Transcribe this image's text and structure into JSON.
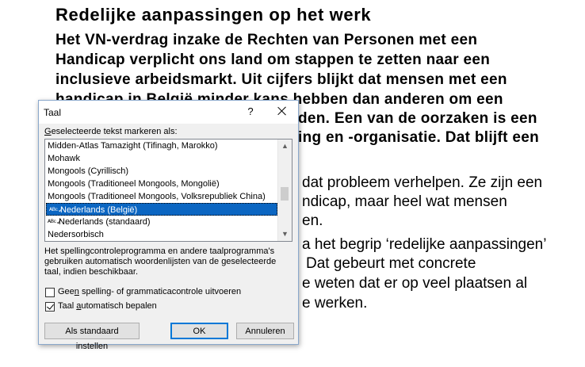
{
  "document": {
    "title": "Redelijke aanpassingen op het werk",
    "lines": [
      "Het VN-verdrag inzake de Rechten van Personen met een",
      "Handicap verplicht ons land om stappen te zetten naar een",
      "inclusieve arbeidsmarkt. Uit cijfers blijkt dat mensen met een",
      "handicap in België minder kans hebben dan anderen om een",
      "den. Een van de oorzaken is een",
      "ing en -organisatie.  Dat blijft  een"
    ],
    "regular_lines": [
      "dat probleem verhelpen. Ze zijn een",
      "ndicap, maar heel wat mensen",
      "en.",
      "a het begrip ‘redelijke aanpassingen’",
      "Dat gebeurt met concrete",
      "e weten dat er op veel plaatsen al",
      "e werken."
    ]
  },
  "dialog": {
    "title": "Taal",
    "help_label": "?",
    "select_label_pre": "",
    "select_label_key": "G",
    "select_label_post": "eselecteerde tekst markeren als:",
    "languages": [
      {
        "label": "Midden-Atlas Tamazight (Tifinagh, Marokko)",
        "spell": false,
        "selected": false
      },
      {
        "label": "Mohawk",
        "spell": false,
        "selected": false
      },
      {
        "label": "Mongools (Cyrillisch)",
        "spell": false,
        "selected": false
      },
      {
        "label": "Mongools (Traditioneel Mongools, Mongolië)",
        "spell": false,
        "selected": false
      },
      {
        "label": "Mongools (Traditioneel Mongools, Volksrepubliek China)",
        "spell": false,
        "selected": false
      },
      {
        "label": "Nederlands (België)",
        "spell": true,
        "selected": true
      },
      {
        "label": "Nederlands (standaard)",
        "spell": true,
        "selected": false
      },
      {
        "label": "Nedersorbisch",
        "spell": false,
        "selected": false
      }
    ],
    "spell_mark": "ᴬᴮᶜ✓",
    "info_text": "Het spellingcontroleprogramma en andere taalprogramma's gebruiken automatisch woordenlijsten van de geselecteerde taal, indien beschikbaar.",
    "no_spell_pre": "Gee",
    "no_spell_key": "n",
    "no_spell_post": " spelling- of grammaticacontrole uitvoeren",
    "no_spell_checked": false,
    "auto_detect_pre": "Taal ",
    "auto_detect_key": "a",
    "auto_detect_post": "utomatisch bepalen",
    "auto_detect_checked": true,
    "btn_default": "Als standaard instellen",
    "btn_ok": "OK",
    "btn_cancel": "Annuleren"
  }
}
